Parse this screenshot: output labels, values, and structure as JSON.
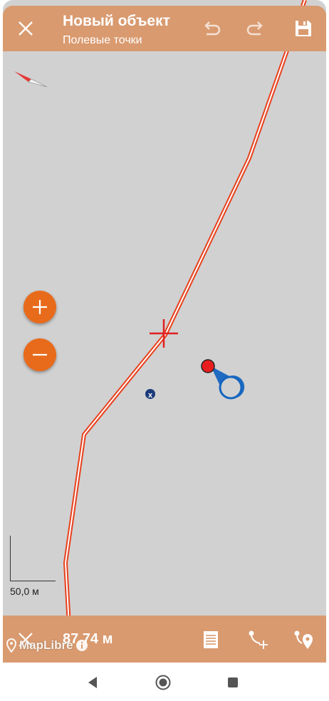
{
  "header": {
    "title": "Новый объект",
    "subtitle": "Полевые точки",
    "icons": [
      "close-icon",
      "undo-icon",
      "redo-icon",
      "save-icon"
    ]
  },
  "map": {
    "scale_label": "50,0 м",
    "attribution": "MapLibre",
    "background_color": "#d1d1d1",
    "line_color": "#e8401c",
    "accent_color": "#e86b1c",
    "location_color": "#1565c0"
  },
  "bottom": {
    "distance": "87,74 м",
    "icons": [
      "close-icon",
      "list-icon",
      "add-vertex-icon",
      "add-point-icon"
    ]
  },
  "navbar": {
    "icons": [
      "back-icon",
      "home-icon",
      "recents-icon"
    ]
  }
}
